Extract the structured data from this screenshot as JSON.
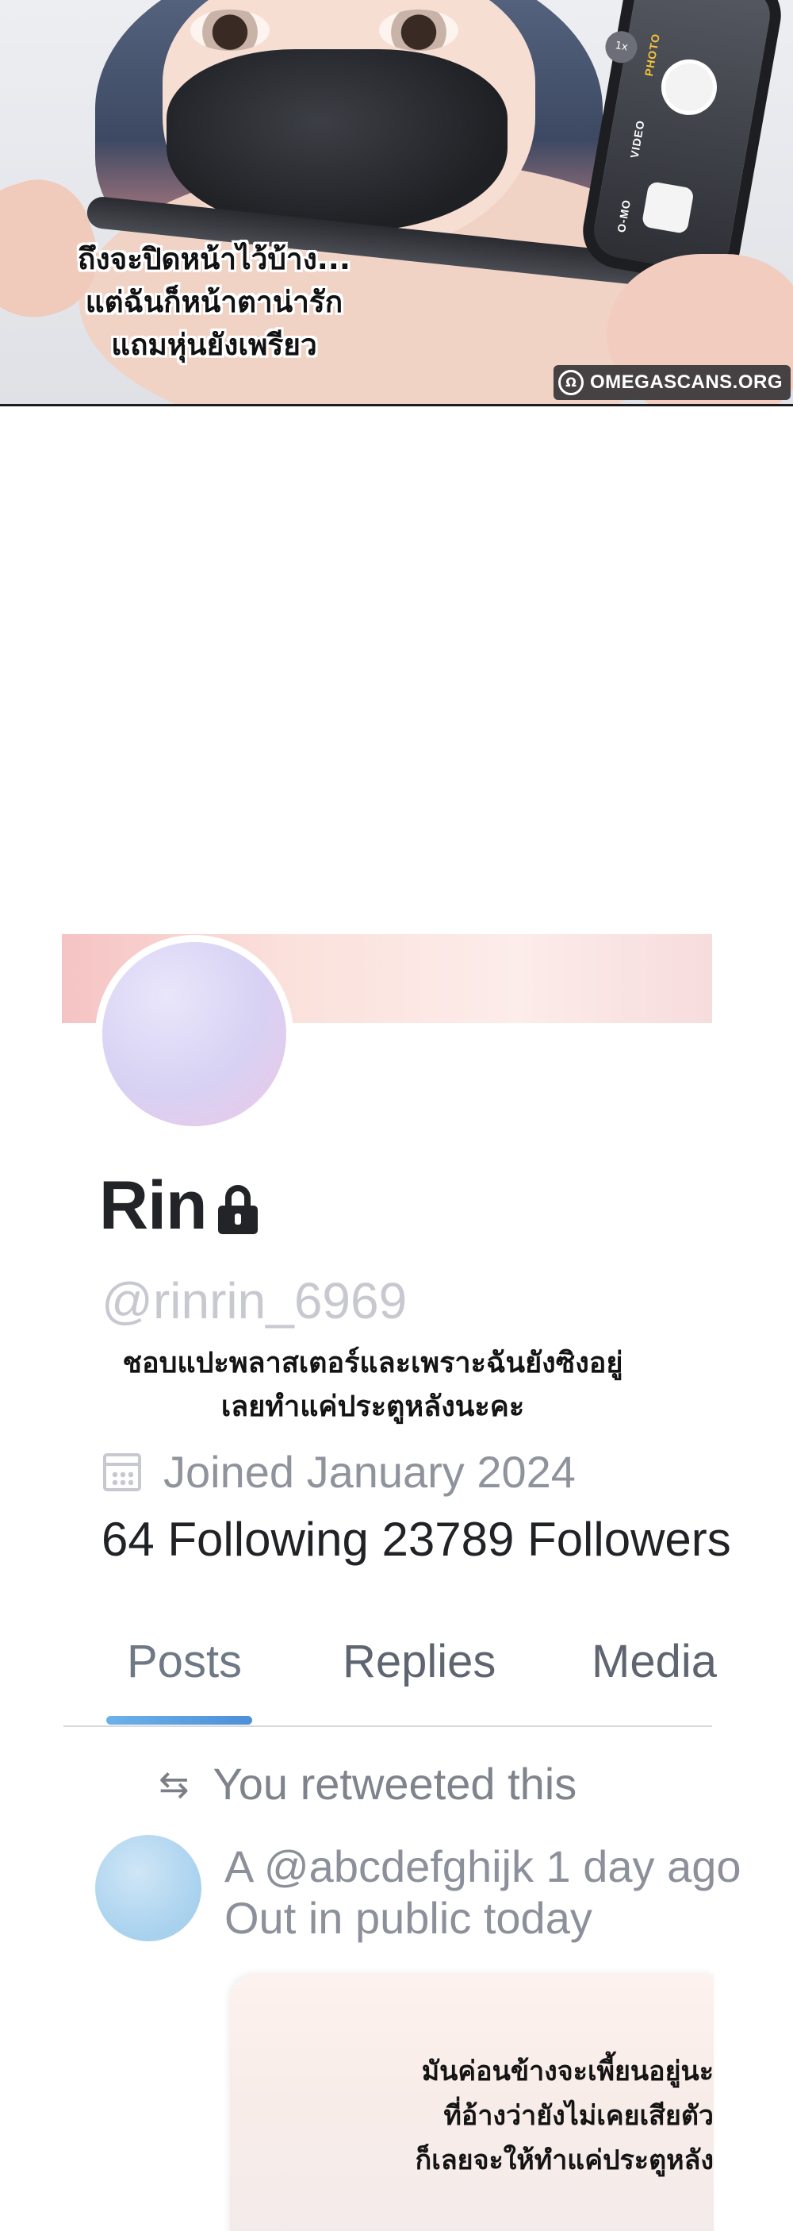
{
  "panel1": {
    "caption_lines": [
      "ถึงจะปิดหน้าไว้บ้าง...",
      "แต่ฉันก็หน้าตาน่ารัก",
      "แถมหุ่นยังเพรียว"
    ],
    "camera": {
      "zoom": "1x",
      "modes": [
        "PHOTO",
        "VIDEO",
        "O-MO"
      ]
    },
    "watermark": {
      "logo": "Ω",
      "text": "OMEGASCANS.ORG"
    }
  },
  "profile": {
    "name": "Rin",
    "handle": "@rinrin_6969",
    "bio_lines": [
      "ชอบแปะพลาสเตอร์และเพราะฉันยังซิงอยู่",
      "เลยทำแค่ประตูหลังนะคะ"
    ],
    "joined": "Joined January 2024",
    "follow_stats": "64 Following 23789 Followers",
    "icons": {
      "lock": "lock-icon",
      "calendar": "calendar-icon",
      "retweet": "retweet-icon"
    }
  },
  "tabs": [
    {
      "label": "Posts",
      "active": true
    },
    {
      "label": "Replies",
      "active": false
    },
    {
      "label": "Media",
      "active": false
    }
  ],
  "feed": {
    "retweet_label": "You retweeted this",
    "retweet_glyph": "⇆",
    "post": {
      "meta": "A @abcdefghijk 1 day ago",
      "text": "Out in public today"
    },
    "caption_lines": [
      "มันค่อนข้างจะเพี้ยนอยู่นะ",
      "ที่อ้างว่ายังไม่เคยเสียตัว",
      "ก็เลยจะให้ทำแค่ประตูหลัง"
    ]
  },
  "colors": {
    "accent_tab": "#4e8fd6",
    "text_dark": "#222428",
    "text_muted": "#8c909a",
    "handle_gray": "#c8c9d0"
  }
}
